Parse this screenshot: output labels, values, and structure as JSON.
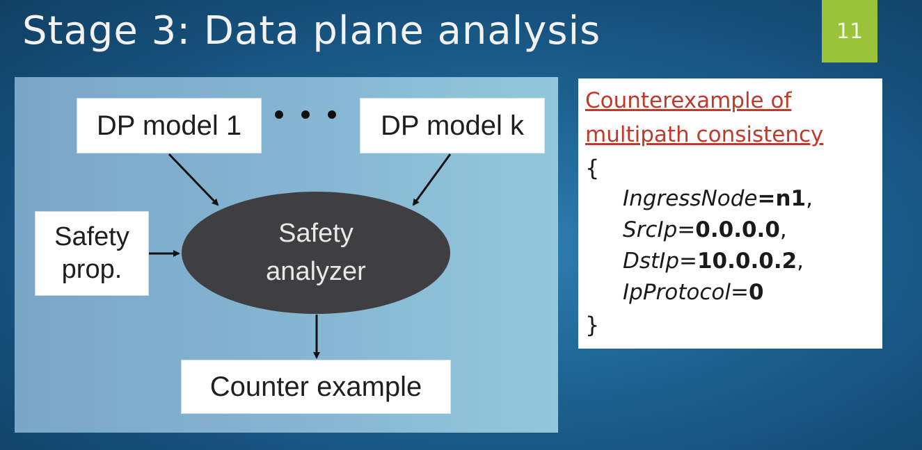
{
  "slide": {
    "title": "Stage 3: Data plane analysis",
    "number": "11"
  },
  "diagram": {
    "dp_model_first": "DP model 1",
    "dp_model_last": "DP model k",
    "safety_prop_line1": "Safety",
    "safety_prop_line2": "prop.",
    "analyzer_line1": "Safety",
    "analyzer_line2": "analyzer",
    "output": "Counter example"
  },
  "panel": {
    "heading_line1": "Counterexample of",
    "heading_line2": "multipath consistency",
    "open_brace": "{",
    "close_brace": "}",
    "fields": [
      {
        "key": "IngressNode",
        "eq": "=",
        "value": "n1",
        "sep": ","
      },
      {
        "key": "SrcIp",
        "eq": "=",
        "value": "0.0.0.0",
        "sep": ","
      },
      {
        "key": "DstIp",
        "eq": "=",
        "value": "10.0.0.2",
        "sep": ","
      },
      {
        "key": "IpProtocol",
        "eq": "=",
        "value": "0",
        "sep": ""
      }
    ]
  },
  "colors": {
    "accent_green": "#9bc33a",
    "heading_red": "#c0392b",
    "ellipse": "#3f3f41"
  }
}
